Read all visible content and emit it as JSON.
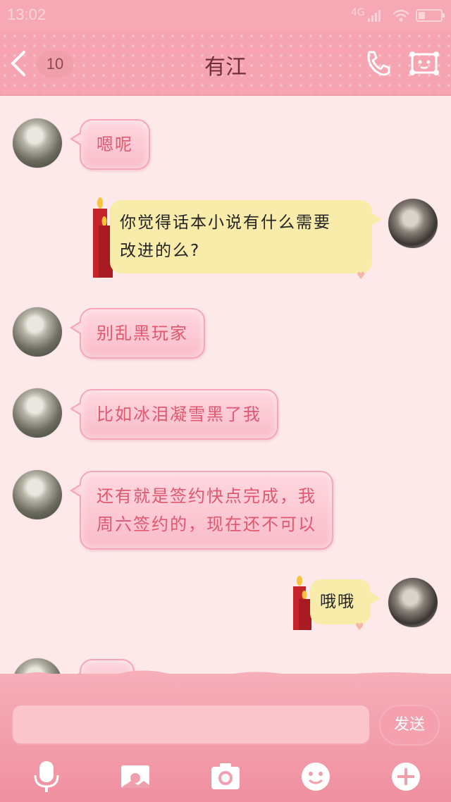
{
  "status_bar": {
    "time": "13:02",
    "signal": "4G"
  },
  "header": {
    "back_count": "10",
    "title": "有江"
  },
  "messages": [
    {
      "side": "left",
      "text": [
        "嗯呢"
      ]
    },
    {
      "side": "right",
      "text": [
        "你觉得话本小说有什么需要",
        "改进的么?"
      ]
    },
    {
      "side": "left",
      "text": [
        "别乱黑玩家"
      ]
    },
    {
      "side": "left",
      "text": [
        "比如冰泪凝雪黑了我"
      ]
    },
    {
      "side": "left",
      "text": [
        "还有就是签约快点完成，我",
        "周六签约的，现在还不可以"
      ]
    },
    {
      "side": "right",
      "text": [
        "哦哦"
      ]
    }
  ],
  "composer": {
    "send_label": "发送"
  },
  "toolbar": {
    "icons": [
      "mic-icon",
      "picture-icon",
      "camera-icon",
      "emoji-icon",
      "plus-icon"
    ]
  },
  "colors": {
    "accent": "#f7a4b2",
    "left_bubble_text": "#e0586f",
    "right_bubble": "#f9ecab"
  }
}
